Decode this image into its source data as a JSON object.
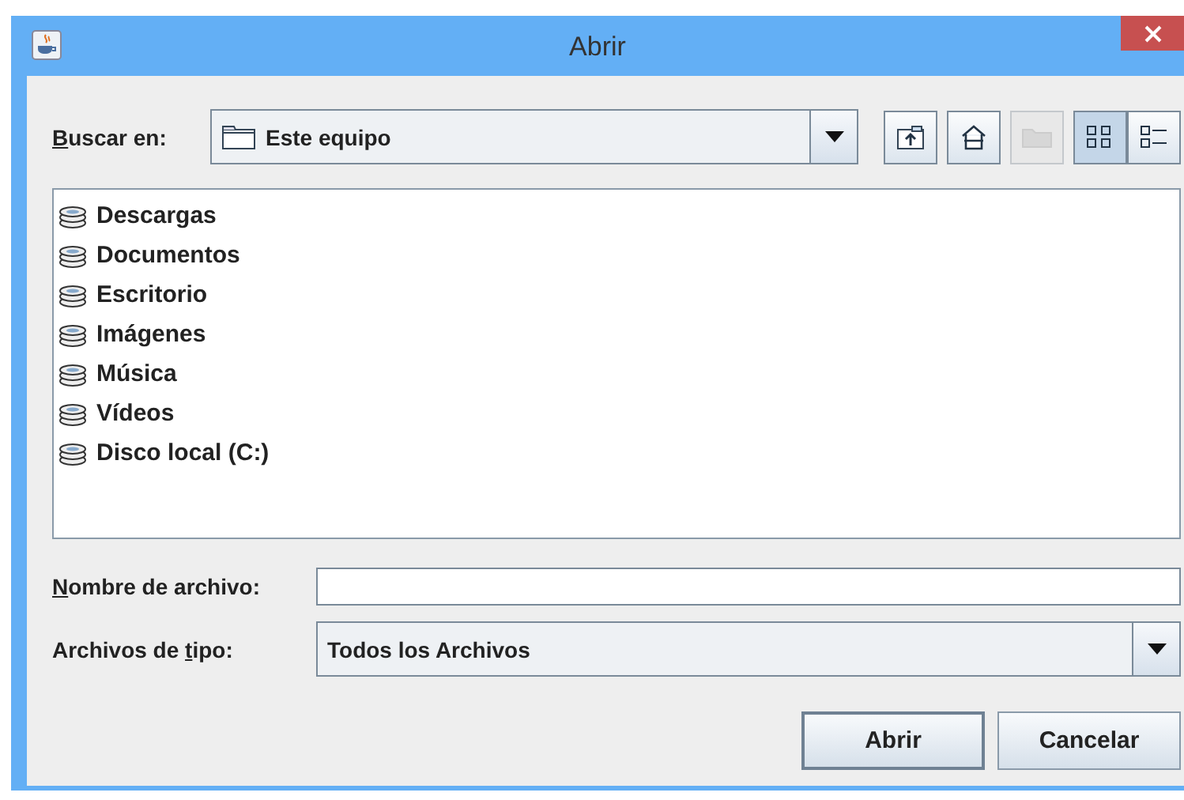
{
  "window": {
    "title": "Abrir"
  },
  "look_in": {
    "label": {
      "key": "B",
      "post": "uscar en:"
    },
    "value": "Este equipo"
  },
  "toolbar": [
    {
      "kind": "up",
      "disabled": false
    },
    {
      "kind": "home",
      "disabled": false
    },
    {
      "kind": "new-folder",
      "disabled": true
    },
    {
      "kind": "list",
      "disabled": false,
      "selected": true
    },
    {
      "kind": "details",
      "disabled": false,
      "selected": false
    }
  ],
  "files": [
    "Descargas",
    "Documentos",
    "Escritorio",
    "Imágenes",
    "Música",
    "Vídeos",
    "Disco local (C:)"
  ],
  "file_name": {
    "label": {
      "key": "N",
      "post": "ombre de archivo:"
    }
  },
  "file_type": {
    "label": {
      "pre": "Archivos de ",
      "key": "t",
      "post": "ipo:"
    },
    "value": "Todos los Archivos"
  },
  "buttons": [
    {
      "label": "Abrir",
      "default": true
    },
    {
      "label": "Cancelar",
      "default": false
    }
  ]
}
